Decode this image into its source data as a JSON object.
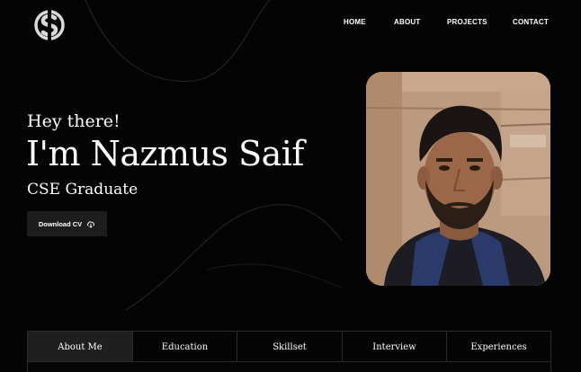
{
  "logo": {
    "icon": "s-monogram-logo"
  },
  "nav": {
    "home": "HOME",
    "about": "ABOUT",
    "projects": "PROJECTS",
    "contact": "CONTACT"
  },
  "hero": {
    "greeting": "Hey there!",
    "name": "I'm Nazmus Saif",
    "role": "CSE Graduate",
    "cv_button": {
      "label": "Download CV",
      "icon": "cloud-download-icon"
    }
  },
  "profile_photo": {
    "icon": "profile-photo"
  },
  "tabs": [
    {
      "label": "About Me",
      "active": true
    },
    {
      "label": "Education",
      "active": false
    },
    {
      "label": "Skillset",
      "active": false
    },
    {
      "label": "Interview",
      "active": false
    },
    {
      "label": "Experiences",
      "active": false
    }
  ],
  "colors": {
    "background": "#040404",
    "button": "#1d1d1d",
    "active_tab": "#1f1f1f",
    "text": "#ffffff"
  }
}
